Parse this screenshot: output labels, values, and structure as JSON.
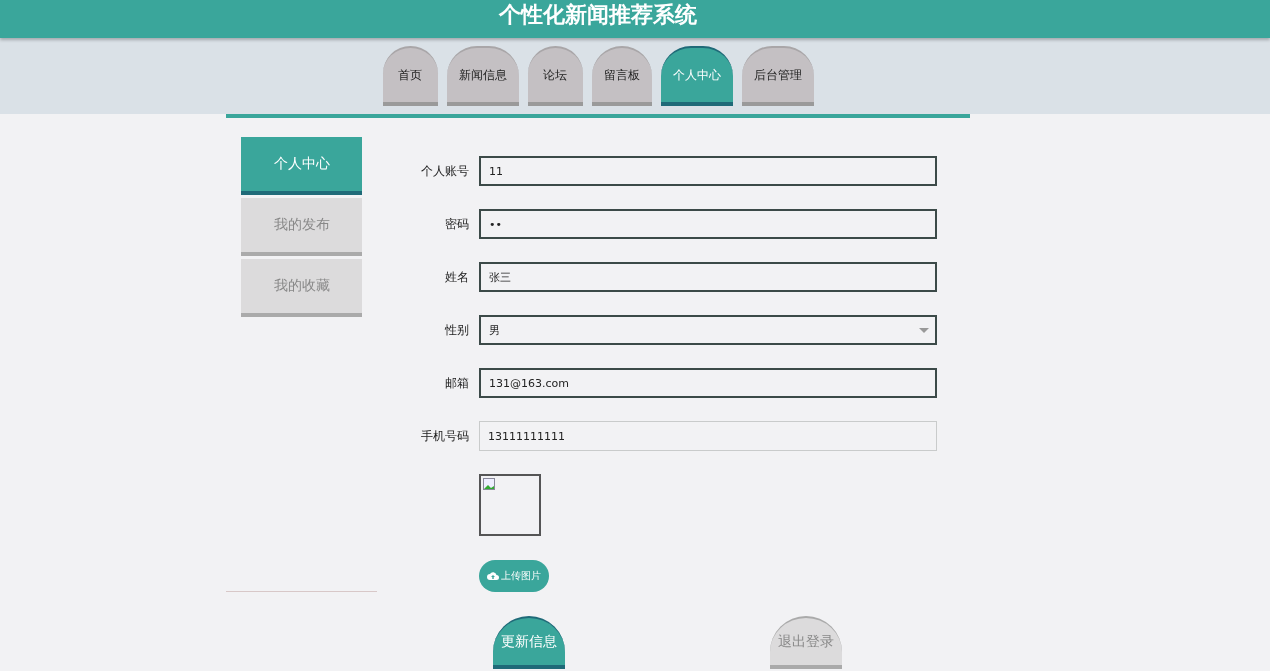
{
  "header": {
    "title": "个性化新闻推荐系统"
  },
  "nav_tabs": [
    {
      "label": "首页",
      "selected": false
    },
    {
      "label": "新闻信息",
      "selected": false
    },
    {
      "label": "论坛",
      "selected": false
    },
    {
      "label": "留言板",
      "selected": false
    },
    {
      "label": "个人中心",
      "selected": true
    },
    {
      "label": "后台管理",
      "selected": false
    }
  ],
  "sidebar": {
    "items": [
      {
        "label": "个人中心",
        "selected": true
      },
      {
        "label": "我的发布",
        "selected": false
      },
      {
        "label": "我的收藏",
        "selected": false
      }
    ]
  },
  "form": {
    "fields": [
      {
        "label": "个人账号",
        "value": "11",
        "kind": "text",
        "disabled": false
      },
      {
        "label": "密码",
        "value": "••",
        "kind": "text",
        "disabled": false
      },
      {
        "label": "姓名",
        "value": "张三",
        "kind": "text",
        "disabled": false
      },
      {
        "label": "性别",
        "value": "男",
        "kind": "select",
        "disabled": false
      },
      {
        "label": "邮箱",
        "value": "131@163.com",
        "kind": "text",
        "disabled": false
      },
      {
        "label": "手机号码",
        "value": "13111111111",
        "kind": "text",
        "disabled": true
      }
    ],
    "upload_button": "上传图片"
  },
  "actions": [
    {
      "label": "更新信息",
      "kind": "primary"
    },
    {
      "label": "退出登录",
      "kind": "secondary"
    }
  ]
}
